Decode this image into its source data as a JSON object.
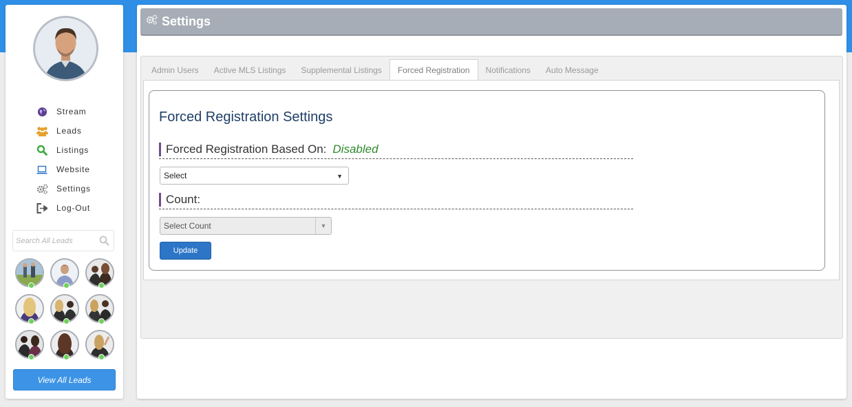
{
  "sidebar": {
    "nav": [
      {
        "label": "Stream",
        "icon": "globe-icon"
      },
      {
        "label": "Leads",
        "icon": "users-icon"
      },
      {
        "label": "Listings",
        "icon": "search-icon"
      },
      {
        "label": "Website",
        "icon": "laptop-icon"
      },
      {
        "label": "Settings",
        "icon": "gears-icon"
      },
      {
        "label": "Log-Out",
        "icon": "logout-icon"
      }
    ],
    "search_placeholder": "Search All Leads",
    "view_all_label": "View All Leads",
    "lead_count": 9
  },
  "page": {
    "title": "Settings"
  },
  "tabs": [
    {
      "label": "Admin Users",
      "active": false
    },
    {
      "label": "Active MLS Listings",
      "active": false
    },
    {
      "label": "Supplemental Listings",
      "active": false
    },
    {
      "label": "Forced Registration",
      "active": true
    },
    {
      "label": "Notifications",
      "active": false
    },
    {
      "label": "Auto Message",
      "active": false
    }
  ],
  "form": {
    "title": "Forced Registration Settings",
    "based_on_label": "Forced Registration Based On:",
    "based_on_status": "Disabled",
    "based_on_select": "Select",
    "count_label": "Count:",
    "count_select": "Select Count",
    "update_label": "Update"
  },
  "colors": {
    "topband": "#2f8fe6",
    "titlebar": "#a7adb6",
    "accent_button": "#2d76c7",
    "status_disabled": "#2e8b2e",
    "online": "#6fd15a"
  }
}
